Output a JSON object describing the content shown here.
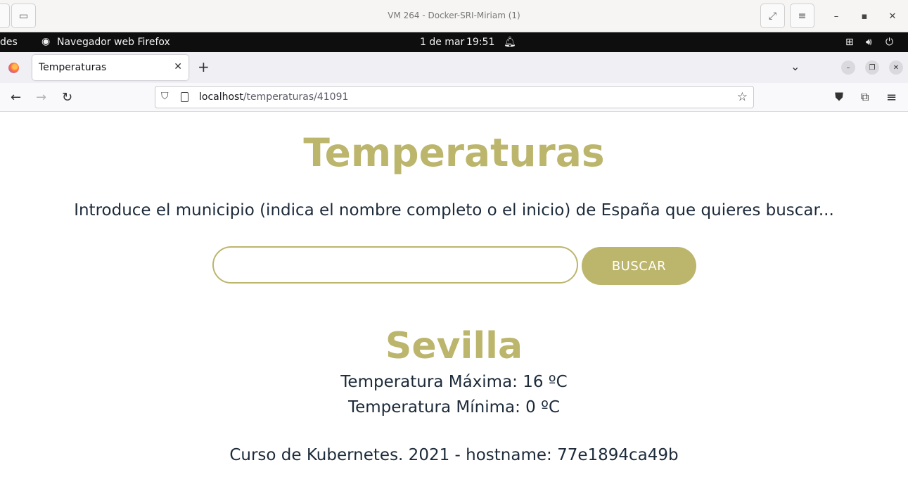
{
  "vm_window": {
    "title": "VM 264 - Docker-SRI-Miriam (1)"
  },
  "gnome_bar": {
    "activities_partial": "des",
    "app_name": "Navegador web Firefox",
    "date": "1 de mar",
    "time": "19:51"
  },
  "browser": {
    "tab_title": "Temperaturas",
    "url_host": "localhost",
    "url_path": "/temperaturas/41091"
  },
  "page": {
    "title": "Temperaturas",
    "prompt": "Introduce el municipio (indica el nombre completo o el inicio) de España que quieres buscar...",
    "search": {
      "value": "",
      "placeholder": "",
      "button_label": "BUSCAR"
    },
    "result": {
      "city": "Sevilla",
      "max_label": "Temperatura Máxima: 16 ºC",
      "min_label": "Temperatura Mínima: 0 ºC"
    },
    "footer": "Curso de Kubernetes. 2021 - hostname: 77e1894ca49b"
  },
  "colors": {
    "accent": "#bcb56c",
    "text": "#1c2a39"
  }
}
